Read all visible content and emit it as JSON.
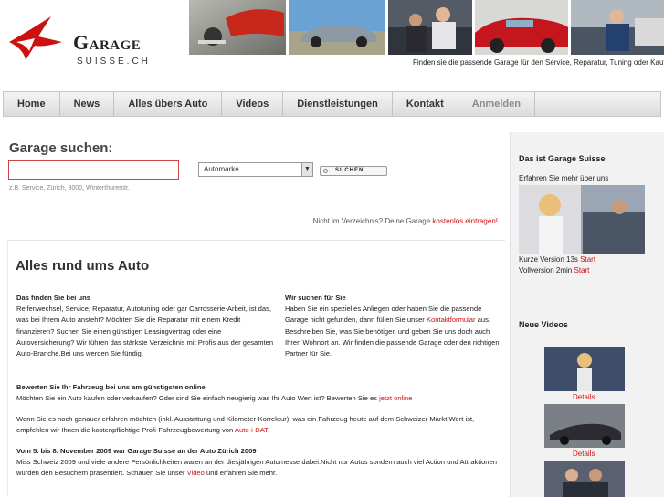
{
  "colors": {
    "brand_red": "#cc1111",
    "nav_text": "#333333",
    "nav_muted": "#8a8a8a"
  },
  "header": {
    "logo_word": "Garage",
    "logo_sub": "SUISSE.CH",
    "tagline": "Finden sie die passende Garage für den Service, Reparatur, Tuning oder Kauf",
    "photos": [
      "keys-and-car-photo",
      "convertible-photo",
      "car-inspection-photo",
      "red-vintage-car-photo",
      "mechanic-photo"
    ]
  },
  "nav": {
    "items": [
      "Home",
      "News",
      "Alles übers Auto",
      "Videos",
      "Dienstleistungen",
      "Kontakt",
      "Anmelden"
    ]
  },
  "search": {
    "title": "Garage suchen:",
    "input_value": "",
    "hint": "z.B. Service, Zürich, 8000, Winterthurerstr.",
    "select_value": "Automarke",
    "button_label": "SUCHEN",
    "not_listed_prefix": "Nicht im Verzeichnis? Deine Garage ",
    "not_listed_link": "kostenlos eintragen!"
  },
  "main": {
    "title": "Alles rund ums Auto",
    "left": {
      "heading": "Das finden Sie bei uns",
      "text": "Reifenwechsel, Service, Reparatur, Autotuning oder gar Carrosserie-Arbeit, ist das, was bei Ihrem Auto ansteht? Möchten Sie die Reparatur mit einem Kredit finanzieren? Suchen Sie einen günstigen Leasingvertrag oder eine Autoversicherung? Wir führen das stärkste Verzeichnis mit Profis aus der gesamten Auto-Branche.Bei uns werden Sie fündig."
    },
    "right": {
      "heading": "Wir suchen für Sie",
      "text_before": "Haben Sie ein spezielles Anliegen oder haben Sie die passende Garage nicht gefunden, dann füllen Sie unser ",
      "link": "Kontaktformular",
      "text_after": " aus. Beschreiben Sie, was Sie benötigen und geben Sie uns doch auch Ihren Wohnort an. Wir finden die passende Garage oder den richtigen Partner für Sie."
    },
    "valuation": {
      "heading": "Bewerten Sie Ihr Fahrzeug bei uns am günstigsten online",
      "text1": "Möchten Sie ein Auto kaufen oder verkaufen? Oder sind Sie einfach neugierig was Ihr Auto Wert ist? Bewerten Sie es ",
      "link1": "jetzt online",
      "text2": "Wenn Sie es noch genauer erfahren möchten (inkl. Ausstattung und Kilometer-Korrektur), was ein Fahrzeug heute auf dem Schweizer Markt Wert ist, empfehlen wir Ihnen die kostenpflichtige Profi-Fahrzeugbewertung von ",
      "link2": "Auto-i-DAT",
      "text2_end": "."
    },
    "event": {
      "heading": "Vom 5. bis 8. November 2009 war Garage Suisse an der Auto Zürich 2009",
      "text_before": "Miss Schweiz 2009 und viele andere Persönlichkeiten waren an der diesjährigen Automesse dabei.Nicht nur Autos sondern auch viel Action und Attraktionen wurden den Besuchern präsentiert. Schauen Sie unser ",
      "link": "Video",
      "text_after": " und erfahren Sie mehr."
    }
  },
  "sidebar": {
    "title1": "Das ist Garage Suisse",
    "intro": "Erfahren Sie mehr über uns",
    "short_label": "Kurze Version 13s ",
    "short_link": "Start",
    "full_label": "Vollversion 2min ",
    "full_link": "Start",
    "title2": "Neue Videos",
    "video_link": "Details"
  }
}
